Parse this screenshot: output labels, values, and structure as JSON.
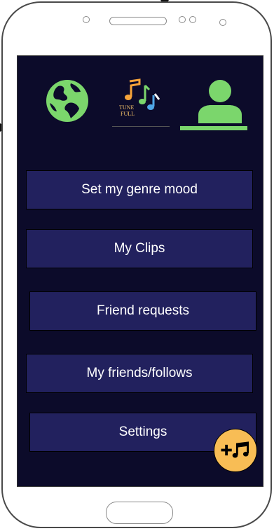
{
  "device": {
    "navbar": {
      "globe_icon": "globe-icon",
      "logo_text_line1": "TUNE",
      "logo_text_line2": "FULL",
      "profile_icon": "person-icon"
    },
    "menu": [
      {
        "label": "Set my genre mood"
      },
      {
        "label": "My Clips"
      },
      {
        "label": "Friend requests"
      },
      {
        "label": "My friends/follows"
      },
      {
        "label": "Settings"
      }
    ],
    "fab_icon": "add-music-icon"
  },
  "colors": {
    "screen_bg": "#0c0b2a",
    "button_bg": "#22215e",
    "accent_green": "#7bd66c",
    "fab_bg": "#f8bd55"
  }
}
